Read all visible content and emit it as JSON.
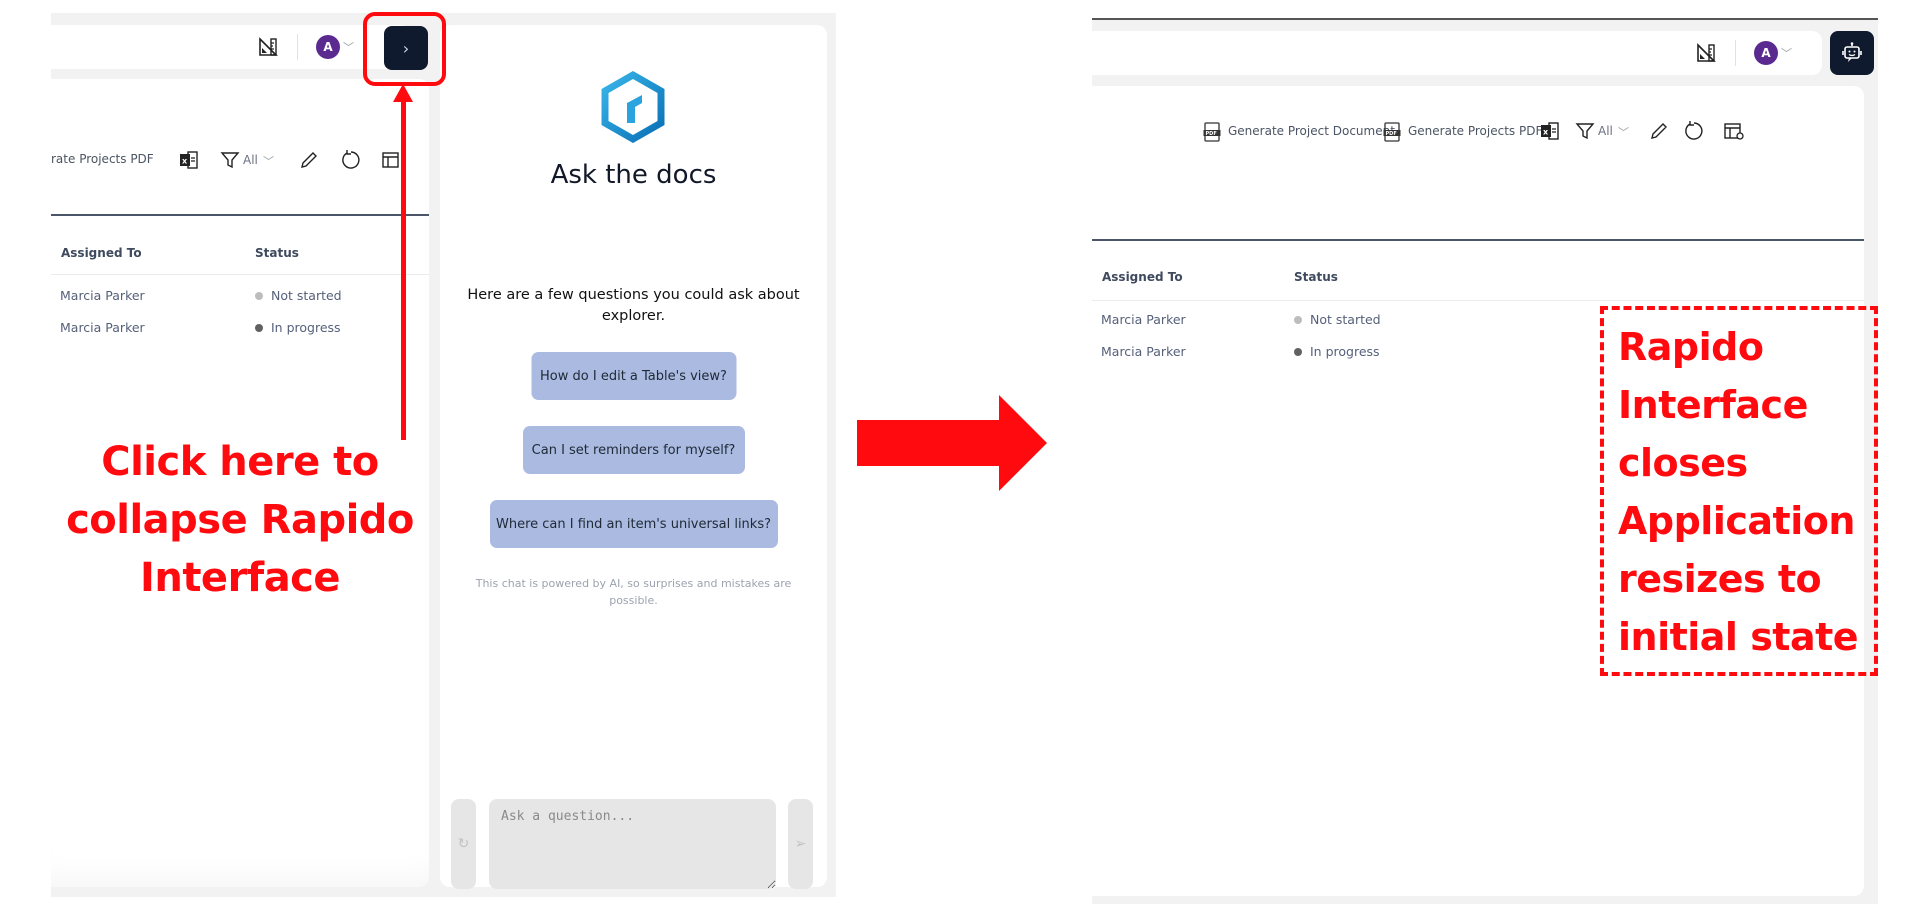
{
  "annotations": {
    "collapse_note": "Click here to collapse Rapido Interface",
    "result_note": "Rapido Interface closes Application resizes to initial state",
    "color": "#ff0a0f"
  },
  "left_view": {
    "topbar": {
      "ruler_icon": "ruler-triangle-icon",
      "avatar_initial": "A",
      "collapse_button_glyph": "›"
    },
    "toolbar": {
      "generate_projects_pdf": "rate Projects PDF",
      "filter_value": "All"
    },
    "table": {
      "columns": [
        "Assigned To",
        "Status"
      ],
      "rows": [
        {
          "assigned_to": "Marcia Parker",
          "status": "Not started",
          "status_color": "#bdbdbd"
        },
        {
          "assigned_to": "Marcia Parker",
          "status": "In progress",
          "status_color": "#616161"
        }
      ]
    },
    "chat": {
      "title": "Ask the docs",
      "intro": "Here are a few questions you could ask about explorer.",
      "suggestions": [
        "How do I edit a Table's view?",
        "Can I set reminders for myself?",
        "Where can I find an item's universal links?"
      ],
      "disclaimer": "This chat is powered by AI, so surprises and mistakes are possible.",
      "input_placeholder": "Ask a question...",
      "reset_glyph": "↻",
      "send_glyph": "➢"
    }
  },
  "right_view": {
    "topbar": {
      "avatar_initial": "A"
    },
    "toolbar": {
      "generate_project_document": "Generate Project Document",
      "generate_projects_pdf": "Generate Projects PDF",
      "filter_value": "All"
    },
    "table": {
      "columns": [
        "Assigned To",
        "Status"
      ],
      "rows": [
        {
          "assigned_to": "Marcia Parker",
          "status": "Not started",
          "status_color": "#bdbdbd"
        },
        {
          "assigned_to": "Marcia Parker",
          "status": "In progress",
          "status_color": "#616161"
        }
      ]
    }
  },
  "colors": {
    "avatar": "#5b2a91",
    "dark_button": "#0f1a2e",
    "suggestion_bg": "#aabae0"
  }
}
